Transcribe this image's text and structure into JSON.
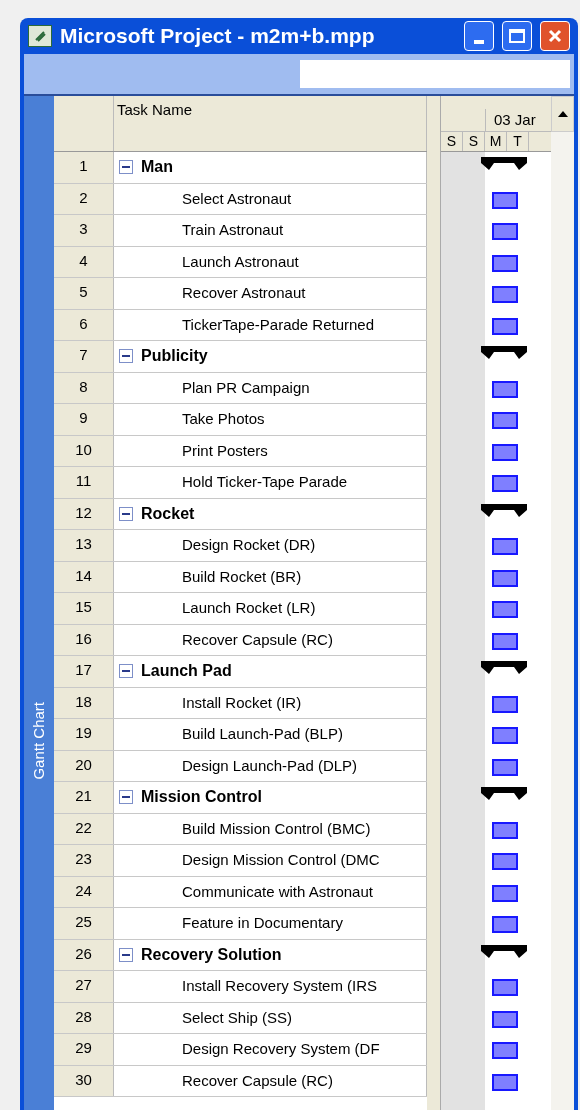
{
  "window": {
    "title": "Microsoft Project - m2m+b.mpp"
  },
  "view_bar": {
    "label": "Gantt Chart"
  },
  "table": {
    "columns": [
      "Task Name"
    ],
    "rows": [
      {
        "id": "1",
        "name": "Man",
        "kind": "summary",
        "expanded": true
      },
      {
        "id": "2",
        "name": "Select Astronaut",
        "kind": "task"
      },
      {
        "id": "3",
        "name": "Train Astronaut",
        "kind": "task"
      },
      {
        "id": "4",
        "name": "Launch Astronaut",
        "kind": "task"
      },
      {
        "id": "5",
        "name": "Recover Astronaut",
        "kind": "task"
      },
      {
        "id": "6",
        "name": "TickerTape-Parade Returned",
        "kind": "task"
      },
      {
        "id": "7",
        "name": "Publicity",
        "kind": "summary",
        "expanded": true
      },
      {
        "id": "8",
        "name": "Plan PR Campaign",
        "kind": "task"
      },
      {
        "id": "9",
        "name": "Take Photos",
        "kind": "task"
      },
      {
        "id": "10",
        "name": "Print Posters",
        "kind": "task"
      },
      {
        "id": "11",
        "name": "Hold Ticker-Tape Parade",
        "kind": "task"
      },
      {
        "id": "12",
        "name": "Rocket",
        "kind": "summary",
        "expanded": true
      },
      {
        "id": "13",
        "name": "Design Rocket (DR)",
        "kind": "task"
      },
      {
        "id": "14",
        "name": "Build Rocket (BR)",
        "kind": "task"
      },
      {
        "id": "15",
        "name": "Launch Rocket (LR)",
        "kind": "task"
      },
      {
        "id": "16",
        "name": "Recover Capsule (RC)",
        "kind": "task"
      },
      {
        "id": "17",
        "name": "Launch Pad",
        "kind": "summary",
        "expanded": true
      },
      {
        "id": "18",
        "name": "Install Rocket (IR)",
        "kind": "task"
      },
      {
        "id": "19",
        "name": "Build Launch-Pad (BLP)",
        "kind": "task"
      },
      {
        "id": "20",
        "name": "Design Launch-Pad (DLP)",
        "kind": "task"
      },
      {
        "id": "21",
        "name": "Mission Control",
        "kind": "summary",
        "expanded": true
      },
      {
        "id": "22",
        "name": "Build Mission Control (BMC)",
        "kind": "task"
      },
      {
        "id": "23",
        "name": "Design Mission Control (DMC",
        "kind": "task"
      },
      {
        "id": "24",
        "name": "Communicate with Astronaut",
        "kind": "task"
      },
      {
        "id": "25",
        "name": "Feature in Documentary",
        "kind": "task"
      },
      {
        "id": "26",
        "name": "Recovery Solution",
        "kind": "summary",
        "expanded": true
      },
      {
        "id": "27",
        "name": "Install Recovery System (IRS",
        "kind": "task"
      },
      {
        "id": "28",
        "name": "Select Ship (SS)",
        "kind": "task"
      },
      {
        "id": "29",
        "name": "Design Recovery System (DF",
        "kind": "task"
      },
      {
        "id": "30",
        "name": "Recover Capsule (RC)",
        "kind": "task"
      }
    ]
  },
  "timescale": {
    "week": "03 Jar",
    "days": [
      "S",
      "S",
      "M",
      "T"
    ]
  }
}
